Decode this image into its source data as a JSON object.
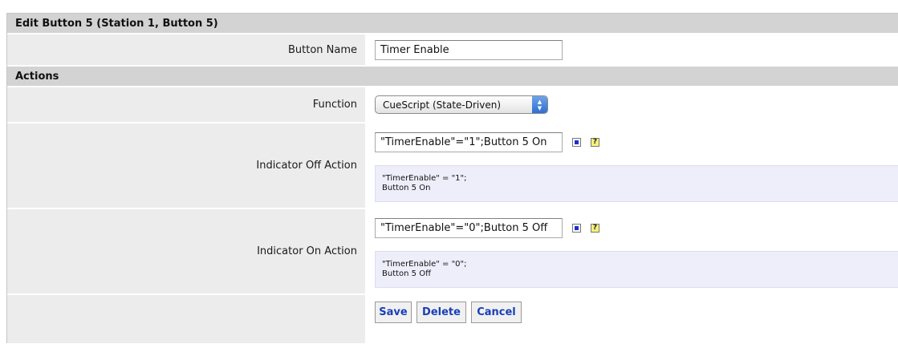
{
  "header": {
    "title": "Edit Button 5 (Station 1, Button 5)"
  },
  "button_name": {
    "label": "Button Name",
    "value": "Timer Enable"
  },
  "actions": {
    "title": "Actions"
  },
  "function": {
    "label": "Function",
    "selected": "CueScript (State-Driven)"
  },
  "indicator_off": {
    "label": "Indicator Off Action",
    "value": "\"TimerEnable\"=\"1\";Button 5 On",
    "preview_line1": "\"TimerEnable\" = \"1\";",
    "preview_line2": "Button 5 On"
  },
  "indicator_on": {
    "label": "Indicator On Action",
    "value": "\"TimerEnable\"=\"0\";Button 5 Off",
    "preview_line1": "\"TimerEnable\" = \"0\";",
    "preview_line2": "Button 5 Off"
  },
  "buttons": {
    "save": "Save",
    "delete": "Delete",
    "cancel": "Cancel"
  },
  "icons": {
    "help": "?"
  }
}
